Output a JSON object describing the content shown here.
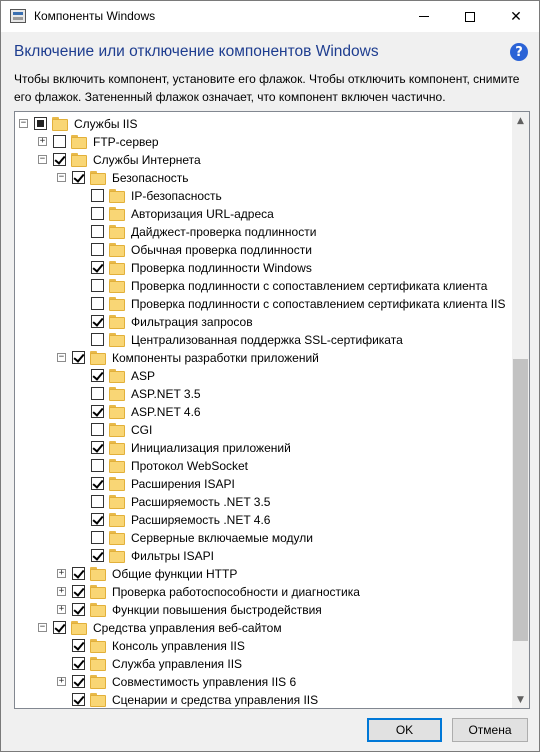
{
  "window": {
    "title": "Компоненты Windows",
    "minimize_glyph": "—",
    "close_glyph": "✕"
  },
  "heading": "Включение или отключение компонентов Windows",
  "help_glyph": "?",
  "description_line1": "Чтобы включить компонент, установите его флажок. Чтобы отключить компонент, снимите",
  "description_line2": "его флажок. Затененный флажок означает, что компонент включен частично.",
  "tree": [
    {
      "label": "Службы IIS",
      "level": 0,
      "expander": "minus",
      "state": "partial"
    },
    {
      "label": "FTP-сервер",
      "level": 1,
      "expander": "plus",
      "state": "unchecked"
    },
    {
      "label": "Службы Интернета",
      "level": 1,
      "expander": "minus",
      "state": "checked"
    },
    {
      "label": "Безопасность",
      "level": 2,
      "expander": "minus",
      "state": "checked"
    },
    {
      "label": "IP-безопасность",
      "level": 3,
      "expander": "none",
      "state": "unchecked"
    },
    {
      "label": "Авторизация URL-адреса",
      "level": 3,
      "expander": "none",
      "state": "unchecked"
    },
    {
      "label": "Дайджест-проверка подлинности",
      "level": 3,
      "expander": "none",
      "state": "unchecked"
    },
    {
      "label": "Обычная проверка подлинности",
      "level": 3,
      "expander": "none",
      "state": "unchecked"
    },
    {
      "label": "Проверка подлинности Windows",
      "level": 3,
      "expander": "none",
      "state": "checked"
    },
    {
      "label": "Проверка подлинности с сопоставлением сертификата клиента",
      "level": 3,
      "expander": "none",
      "state": "unchecked"
    },
    {
      "label": "Проверка подлинности с сопоставлением сертификата клиента IIS",
      "level": 3,
      "expander": "none",
      "state": "unchecked"
    },
    {
      "label": "Фильтрация запросов",
      "level": 3,
      "expander": "none",
      "state": "checked"
    },
    {
      "label": "Централизованная поддержка SSL-сертификата",
      "level": 3,
      "expander": "none",
      "state": "unchecked"
    },
    {
      "label": "Компоненты разработки приложений",
      "level": 2,
      "expander": "minus",
      "state": "checked"
    },
    {
      "label": "ASP",
      "level": 3,
      "expander": "none",
      "state": "checked"
    },
    {
      "label": "ASP.NET 3.5",
      "level": 3,
      "expander": "none",
      "state": "unchecked"
    },
    {
      "label": "ASP.NET 4.6",
      "level": 3,
      "expander": "none",
      "state": "checked"
    },
    {
      "label": "CGI",
      "level": 3,
      "expander": "none",
      "state": "unchecked"
    },
    {
      "label": "Инициализация приложений",
      "level": 3,
      "expander": "none",
      "state": "checked"
    },
    {
      "label": "Протокол WebSocket",
      "level": 3,
      "expander": "none",
      "state": "unchecked"
    },
    {
      "label": "Расширения ISAPI",
      "level": 3,
      "expander": "none",
      "state": "checked"
    },
    {
      "label": "Расширяемость .NET 3.5",
      "level": 3,
      "expander": "none",
      "state": "unchecked"
    },
    {
      "label": "Расширяемость .NET 4.6",
      "level": 3,
      "expander": "none",
      "state": "checked"
    },
    {
      "label": "Серверные включаемые модули",
      "level": 3,
      "expander": "none",
      "state": "unchecked"
    },
    {
      "label": "Фильтры ISAPI",
      "level": 3,
      "expander": "none",
      "state": "checked"
    },
    {
      "label": "Общие функции HTTP",
      "level": 2,
      "expander": "plus",
      "state": "checked"
    },
    {
      "label": "Проверка работоспособности и диагностика",
      "level": 2,
      "expander": "plus",
      "state": "checked"
    },
    {
      "label": "Функции повышения быстродействия",
      "level": 2,
      "expander": "plus",
      "state": "checked"
    },
    {
      "label": "Средства управления веб-сайтом",
      "level": 1,
      "expander": "minus",
      "state": "checked"
    },
    {
      "label": "Консоль управления IIS",
      "level": 2,
      "expander": "none",
      "state": "checked"
    },
    {
      "label": "Служба управления IIS",
      "level": 2,
      "expander": "none",
      "state": "checked"
    },
    {
      "label": "Совместимость управления IIS 6",
      "level": 2,
      "expander": "plus",
      "state": "checked"
    },
    {
      "label": "Сценарии и средства управления IIS",
      "level": 2,
      "expander": "none",
      "state": "checked"
    }
  ],
  "buttons": {
    "ok": "OK",
    "cancel": "Отмена"
  }
}
